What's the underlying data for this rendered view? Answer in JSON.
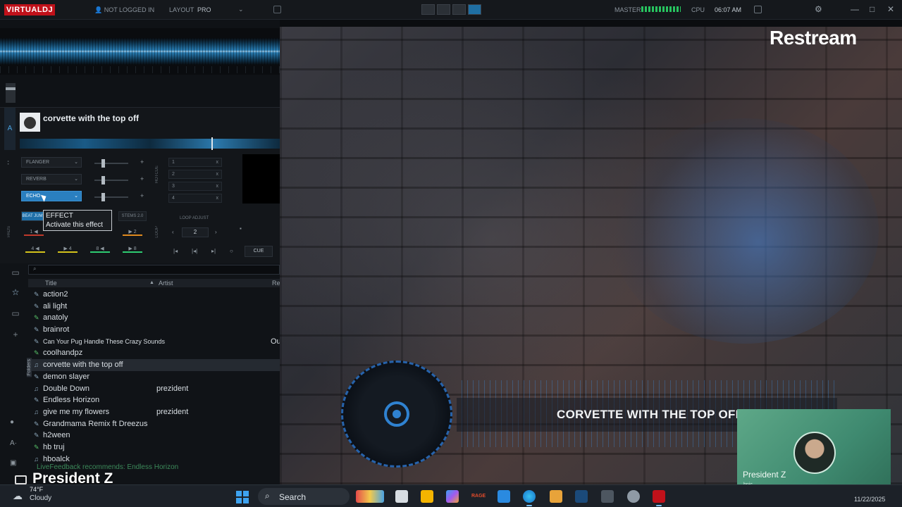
{
  "app": {
    "logo": "VIRTUALDJ",
    "user_status": "NOT LOGGED IN",
    "layout_label": "LAYOUT",
    "layout_value": "PRO",
    "master_label": "MASTER",
    "cpu_label": "CPU",
    "clock": "06:07 AM"
  },
  "deck": {
    "id": "A",
    "track_title": "corvette with the top off",
    "effects": [
      {
        "name": "FLANGER",
        "active": false
      },
      {
        "name": "REVERB",
        "active": false
      },
      {
        "name": "ECHO",
        "active": true
      }
    ],
    "hotcues": [
      "1",
      "2",
      "3",
      "4"
    ],
    "tabs": [
      "BEAT JUMP",
      "STEMS 2.0"
    ],
    "loop_adjust_label": "LOOP ADJUST",
    "loop_value": "2",
    "pads": [
      {
        "label": "1 ◀",
        "color": "r"
      },
      {
        "label": "▶ 2",
        "color": "o"
      },
      {
        "label": "4 ◀",
        "color": "y"
      },
      {
        "label": "▶ 4",
        "color": "y"
      },
      {
        "label": "8 ◀",
        "color": "g"
      },
      {
        "label": "▶ 8",
        "color": "g"
      }
    ],
    "cue_label": "CUE",
    "side_labels": {
      "hotcue": "HOTCUE",
      "pads": "PADS",
      "loop": "LOOP"
    }
  },
  "tooltip": {
    "heading": "EFFECT",
    "description": "Activate this effect"
  },
  "browser": {
    "columns": {
      "title": "Title",
      "artist": "Artist",
      "remix": "Re"
    },
    "folders_label": "Folders",
    "rows": [
      {
        "title": "action2",
        "artist": "",
        "extra": "",
        "icon": "✎",
        "green": false,
        "small": false
      },
      {
        "title": "ali light",
        "artist": "",
        "extra": "",
        "icon": "✎",
        "green": false,
        "small": false
      },
      {
        "title": "anatoly",
        "artist": "",
        "extra": "",
        "icon": "✎",
        "green": true,
        "small": false
      },
      {
        "title": "brainrot",
        "artist": "",
        "extra": "",
        "icon": "✎",
        "green": false,
        "small": false
      },
      {
        "title": "Can Your Pug Handle These Crazy Sounds",
        "artist": "",
        "extra": "Ou",
        "icon": "✎",
        "green": false,
        "small": true
      },
      {
        "title": "coolhandpz",
        "artist": "",
        "extra": "",
        "icon": "✎",
        "green": true,
        "small": false
      },
      {
        "title": "corvette with the top off",
        "artist": "",
        "extra": "",
        "icon": "♫",
        "green": false,
        "small": false,
        "selected": true
      },
      {
        "title": "demon slayer",
        "artist": "",
        "extra": "",
        "icon": "✎",
        "green": false,
        "small": false
      },
      {
        "title": "Double Down",
        "artist": "prezident",
        "extra": "",
        "icon": "♫",
        "green": false,
        "small": false
      },
      {
        "title": "Endless Horizon",
        "artist": "",
        "extra": "",
        "icon": "✎",
        "green": false,
        "small": false
      },
      {
        "title": "give me my flowers",
        "artist": "prezident",
        "extra": "",
        "icon": "♫",
        "green": false,
        "small": false
      },
      {
        "title": "Grandmama Remix ft Dreezus",
        "artist": "",
        "extra": "",
        "icon": "✎",
        "green": false,
        "small": false
      },
      {
        "title": "h2ween",
        "artist": "",
        "extra": "",
        "icon": "✎",
        "green": false,
        "small": false
      },
      {
        "title": "hb truj",
        "artist": "",
        "extra": "",
        "icon": "✎",
        "green": true,
        "small": false
      },
      {
        "title": "hboalck",
        "artist": "",
        "extra": "",
        "icon": "♫",
        "green": false,
        "small": false
      }
    ],
    "livefeedback": "LiveFeedback recommends: Endless Horizon"
  },
  "stream": {
    "brand": "Restream",
    "now_playing": "CORVETTE WITH THE TOP OFF",
    "host_name": "President Z",
    "host_sub": "hnic",
    "overlay_name": "President Z"
  },
  "taskbar": {
    "weather_temp": "74°F",
    "weather_desc": "Cloudy",
    "search_placeholder": "Search",
    "date": "11/22/2025"
  }
}
